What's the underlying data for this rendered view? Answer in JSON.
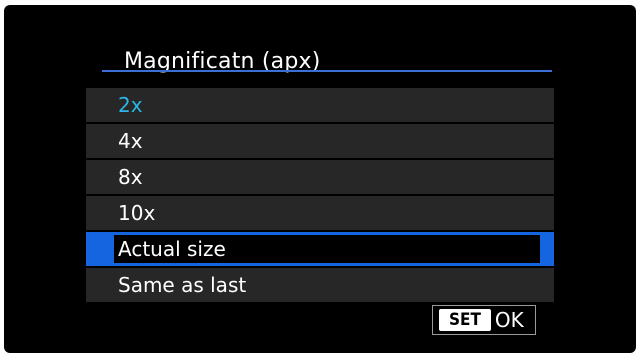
{
  "menu": {
    "title": "Magnificatn (apx)",
    "items": [
      {
        "label": "2x"
      },
      {
        "label": "4x"
      },
      {
        "label": "8x"
      },
      {
        "label": "10x"
      },
      {
        "label": "Actual size"
      },
      {
        "label": "Same as last"
      }
    ],
    "current_index": 0,
    "selected_index": 4
  },
  "footer": {
    "set_label": "SET",
    "ok_label": "OK"
  },
  "colors": {
    "accent": "#1565e0",
    "current_value": "#2ab8e8",
    "row_bg": "#272727",
    "background": "#000000"
  }
}
